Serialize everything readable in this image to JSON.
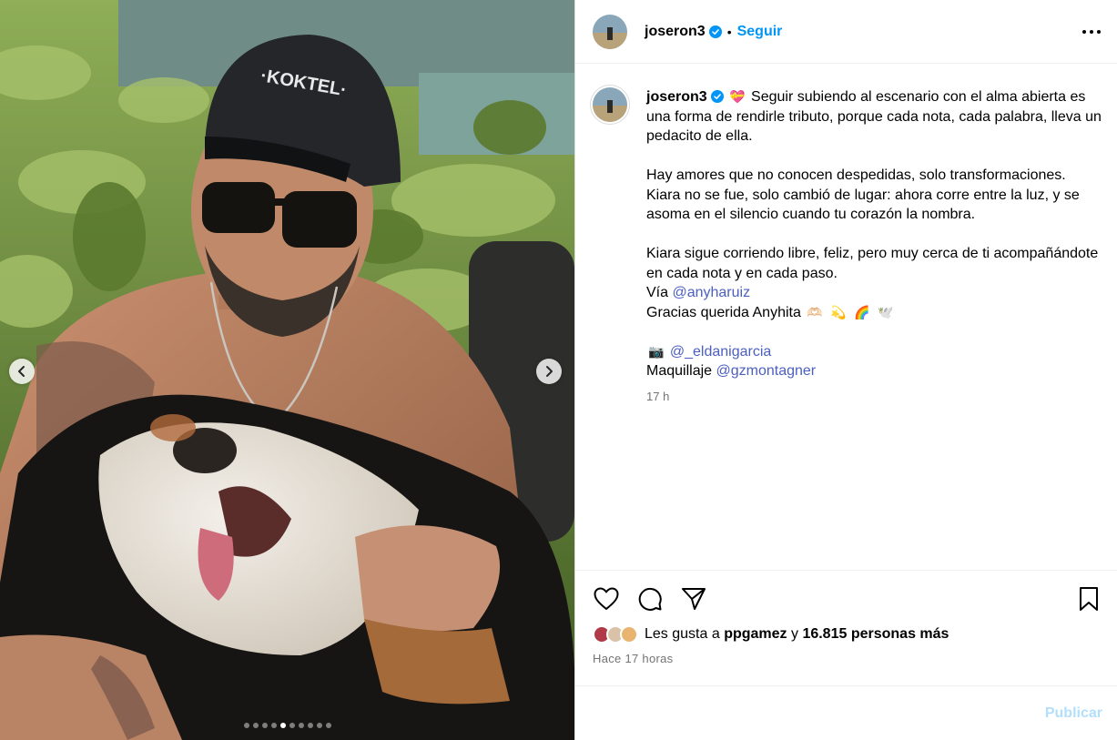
{
  "post": {
    "username": "joseron3",
    "follow_label": "Seguir",
    "separator": "•",
    "caption": {
      "username": "joseron3",
      "lines": {
        "p1": "Seguir subiendo al escenario con el alma abierta es una forma de rendirle tributo, porque cada nota, cada palabra, lleva un pedacito de ella.",
        "p2": "Hay amores que no conocen despedidas, solo transformaciones. Kiara no se fue, solo cambió de lugar: ahora corre entre la luz, y se asoma en el silencio cuando tu corazón la nombra.",
        "p3": "Kiara sigue corriendo libre, feliz, pero muy cerca de ti acompañándote en cada nota y en cada paso.",
        "via_prefix": "Vía",
        "via_mention": "@anyharuiz",
        "thanks": "Gracias querida Anyhita",
        "photo_mention": "@_eldanigarcia",
        "makeup_prefix": "Maquillaje",
        "makeup_mention": "@gzmontagner"
      },
      "emojis": {
        "heart": "💝",
        "thanks_1": "🫶🏻",
        "thanks_2": "💫",
        "thanks_3": "🌈",
        "thanks_4": "🕊️",
        "camera": "📷"
      },
      "time": "17 h"
    },
    "likes": {
      "prefix": "Les gusta a",
      "user": "ppgamez",
      "connector": "y",
      "count_text": "16.815 personas más"
    },
    "post_time": "Hace 17 horas",
    "comment_placeholder": "",
    "publish_label": "Publicar",
    "media": {
      "cap_text": "·KOKTEL·",
      "carousel_total": 10,
      "carousel_active": 4
    }
  },
  "colors": {
    "accent": "#0095f6",
    "mention": "#4b5fc1",
    "muted": "#737373",
    "publish_disabled": "#b2dffc"
  },
  "icons": {
    "verified": "verified-badge-icon",
    "more": "more-options-icon",
    "like": "heart-icon",
    "comment": "comment-icon",
    "share": "share-icon",
    "save": "bookmark-icon",
    "prev": "chevron-left-icon",
    "next": "chevron-right-icon"
  }
}
